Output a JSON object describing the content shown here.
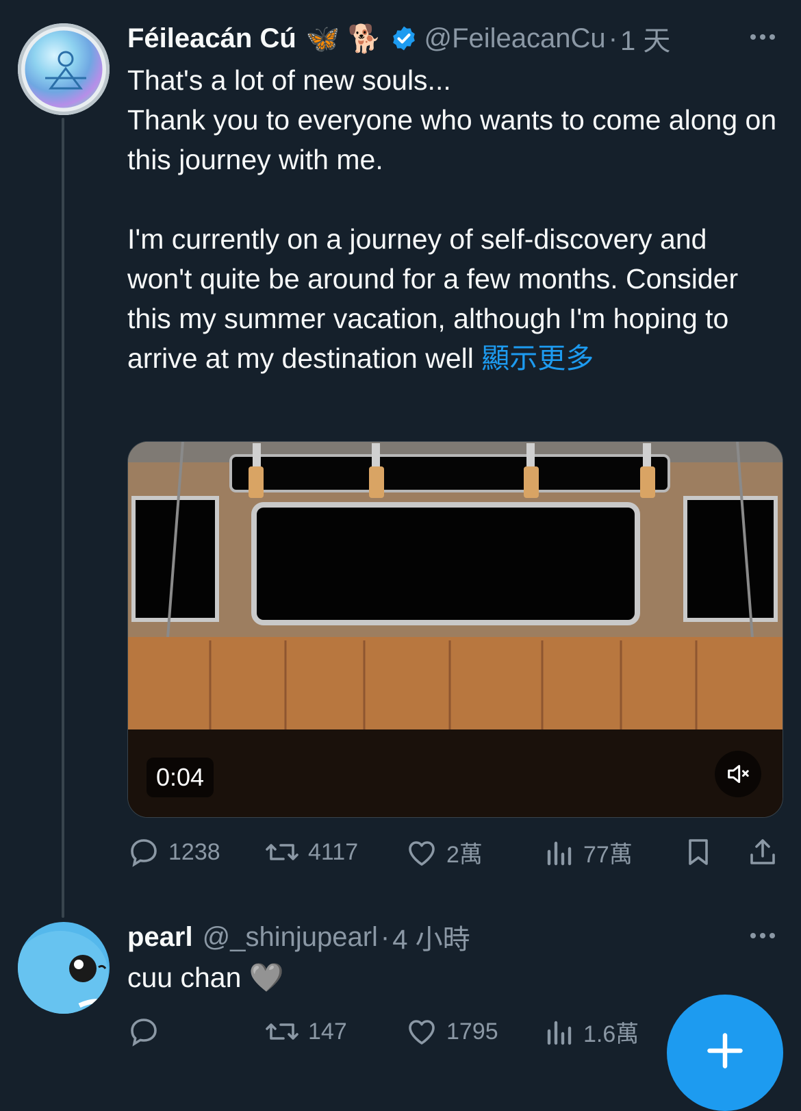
{
  "tweet": {
    "author_name": "Féileacán Cú",
    "author_emojis": "🦋 🐕",
    "handle": "@FeileacanCu",
    "separator": "·",
    "time": "1 天",
    "text_lines": [
      "That's a lot of new souls...",
      "Thank you to everyone who wants to come along on this journey with me.",
      "I'm currently on a journey of self-discovery and won't quite be around for a few months. Consider this my summer vacation, although I'm hoping to arrive at my destination well"
    ],
    "show_more": "顯示更多",
    "video": {
      "duration": "0:04"
    },
    "stats": {
      "replies": "1238",
      "retweets": "4117",
      "likes": "2萬",
      "views": "77萬"
    }
  },
  "reply": {
    "author_name": "pearl",
    "handle": "@_shinjupearl",
    "separator": "·",
    "time": "4 小時",
    "text": "cuu chan",
    "emoji": "🩶",
    "stats": {
      "replies": "",
      "retweets": "147",
      "likes": "1795",
      "views": "1.6萬"
    }
  },
  "icons": [
    "more-icon",
    "verified-icon",
    "mute-icon",
    "reply-icon",
    "retweet-icon",
    "like-icon",
    "views-icon",
    "bookmark-icon",
    "share-icon",
    "compose-plus-icon"
  ],
  "colors": {
    "background": "#15202b",
    "accent": "#1d9bf0",
    "muted": "#8b98a5",
    "text": "#f7f9f9"
  }
}
